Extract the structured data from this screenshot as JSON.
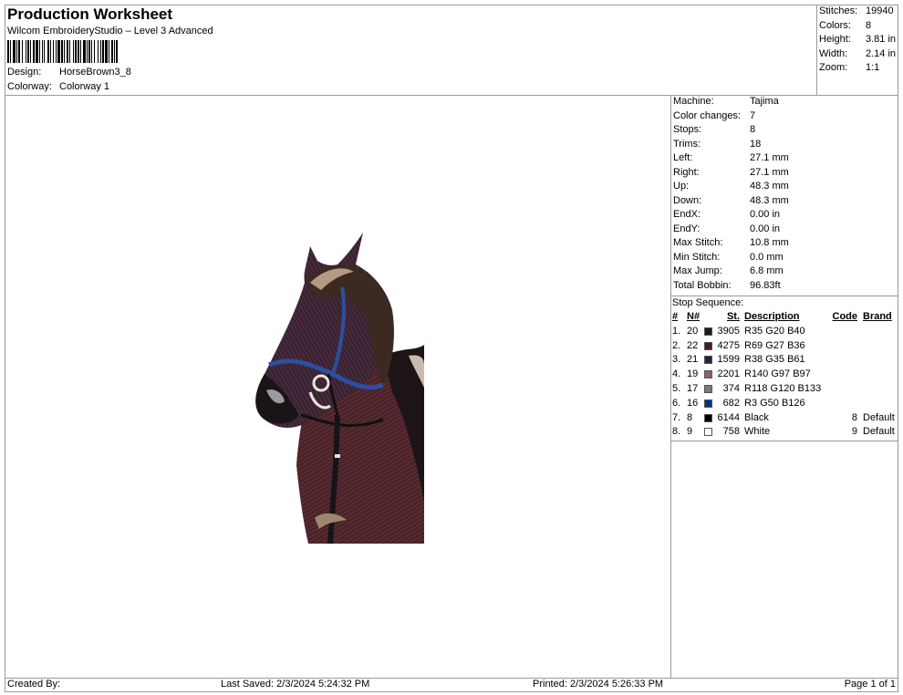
{
  "header": {
    "title": "Production Worksheet",
    "subtitle": "Wilcom EmbroideryStudio – Level 3 Advanced",
    "design_label": "Design:",
    "design_value": "HorseBrown3_8",
    "colorway_label": "Colorway:",
    "colorway_value": "Colorway 1"
  },
  "stats": [
    {
      "label": "Stitches:",
      "value": "19940"
    },
    {
      "label": "Colors:",
      "value": "8"
    },
    {
      "label": "Height:",
      "value": "3.81 in"
    },
    {
      "label": "Width:",
      "value": "2.14 in"
    },
    {
      "label": "Zoom:",
      "value": "1:1"
    }
  ],
  "machine_info": [
    {
      "label": "Machine:",
      "value": "Tajima"
    },
    {
      "label": "Color changes:",
      "value": "7"
    },
    {
      "label": "Stops:",
      "value": "8"
    },
    {
      "label": "Trims:",
      "value": "18"
    },
    {
      "label": "Left:",
      "value": "27.1 mm"
    },
    {
      "label": "Right:",
      "value": "27.1 mm"
    },
    {
      "label": "Up:",
      "value": "48.3 mm"
    },
    {
      "label": "Down:",
      "value": "48.3 mm"
    },
    {
      "label": "EndX:",
      "value": "0.00 in"
    },
    {
      "label": "EndY:",
      "value": "0.00 in"
    },
    {
      "label": "Max Stitch:",
      "value": "10.8 mm"
    },
    {
      "label": "Min Stitch:",
      "value": "0.0 mm"
    },
    {
      "label": "Max Jump:",
      "value": "6.8 mm"
    },
    {
      "label": "Total Bobbin:",
      "value": "96.83ft"
    }
  ],
  "stop_sequence": {
    "title": "Stop Sequence:",
    "columns": {
      "idx": "#",
      "n": "N#",
      "st": "St.",
      "description": "Description",
      "code": "Code",
      "brand": "Brand"
    },
    "rows": [
      {
        "idx": "1.",
        "n": "20",
        "color": "#231428",
        "st": "3905",
        "description": "R35 G20 B40",
        "code": "",
        "brand": ""
      },
      {
        "idx": "2.",
        "n": "22",
        "color": "#451B24",
        "st": "4275",
        "description": "R69 G27 B36",
        "code": "",
        "brand": ""
      },
      {
        "idx": "3.",
        "n": "21",
        "color": "#26233D",
        "st": "1599",
        "description": "R38 G35 B61",
        "code": "",
        "brand": ""
      },
      {
        "idx": "4.",
        "n": "19",
        "color": "#8C6161",
        "st": "2201",
        "description": "R140 G97 B97",
        "code": "",
        "brand": ""
      },
      {
        "idx": "5.",
        "n": "17",
        "color": "#767885",
        "st": "374",
        "description": "R118 G120 B133",
        "code": "",
        "brand": ""
      },
      {
        "idx": "6.",
        "n": "16",
        "color": "#03327E",
        "st": "682",
        "description": "R3 G50 B126",
        "code": "",
        "brand": ""
      },
      {
        "idx": "7.",
        "n": "8",
        "color": "#000000",
        "st": "6144",
        "description": "Black",
        "code": "8",
        "brand": "Default"
      },
      {
        "idx": "8.",
        "n": "9",
        "color": "#FFFFFF",
        "st": "758",
        "description": "White",
        "code": "9",
        "brand": "Default"
      }
    ]
  },
  "footer": {
    "created_by": "Created By:",
    "last_saved": "Last Saved: 2/3/2024 5:24:32 PM",
    "printed": "Printed: 2/3/2024 5:26:33 PM",
    "page": "Page 1 of 1"
  }
}
